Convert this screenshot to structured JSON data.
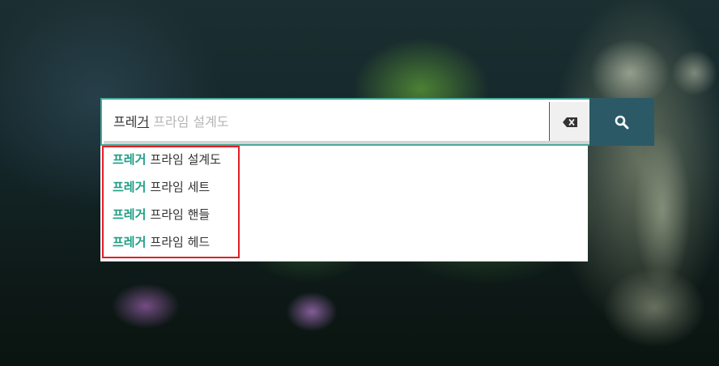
{
  "search": {
    "typed_prefix": "프레",
    "typed_composing": "거",
    "ghost_completion": "프라임 설계도",
    "clear_icon": "backspace-clear-icon",
    "search_icon": "magnifier-icon"
  },
  "suggestions": [
    {
      "match": "프레거",
      "rest": "프라임 설계도"
    },
    {
      "match": "프레거",
      "rest": "프라임 세트"
    },
    {
      "match": "프레거",
      "rest": "프라임 핸들"
    },
    {
      "match": "프레거",
      "rest": "프라임 헤드"
    }
  ],
  "colors": {
    "accent_teal": "#1f9e86",
    "search_button": "#2b5a66",
    "highlight_red": "#e21e26"
  }
}
